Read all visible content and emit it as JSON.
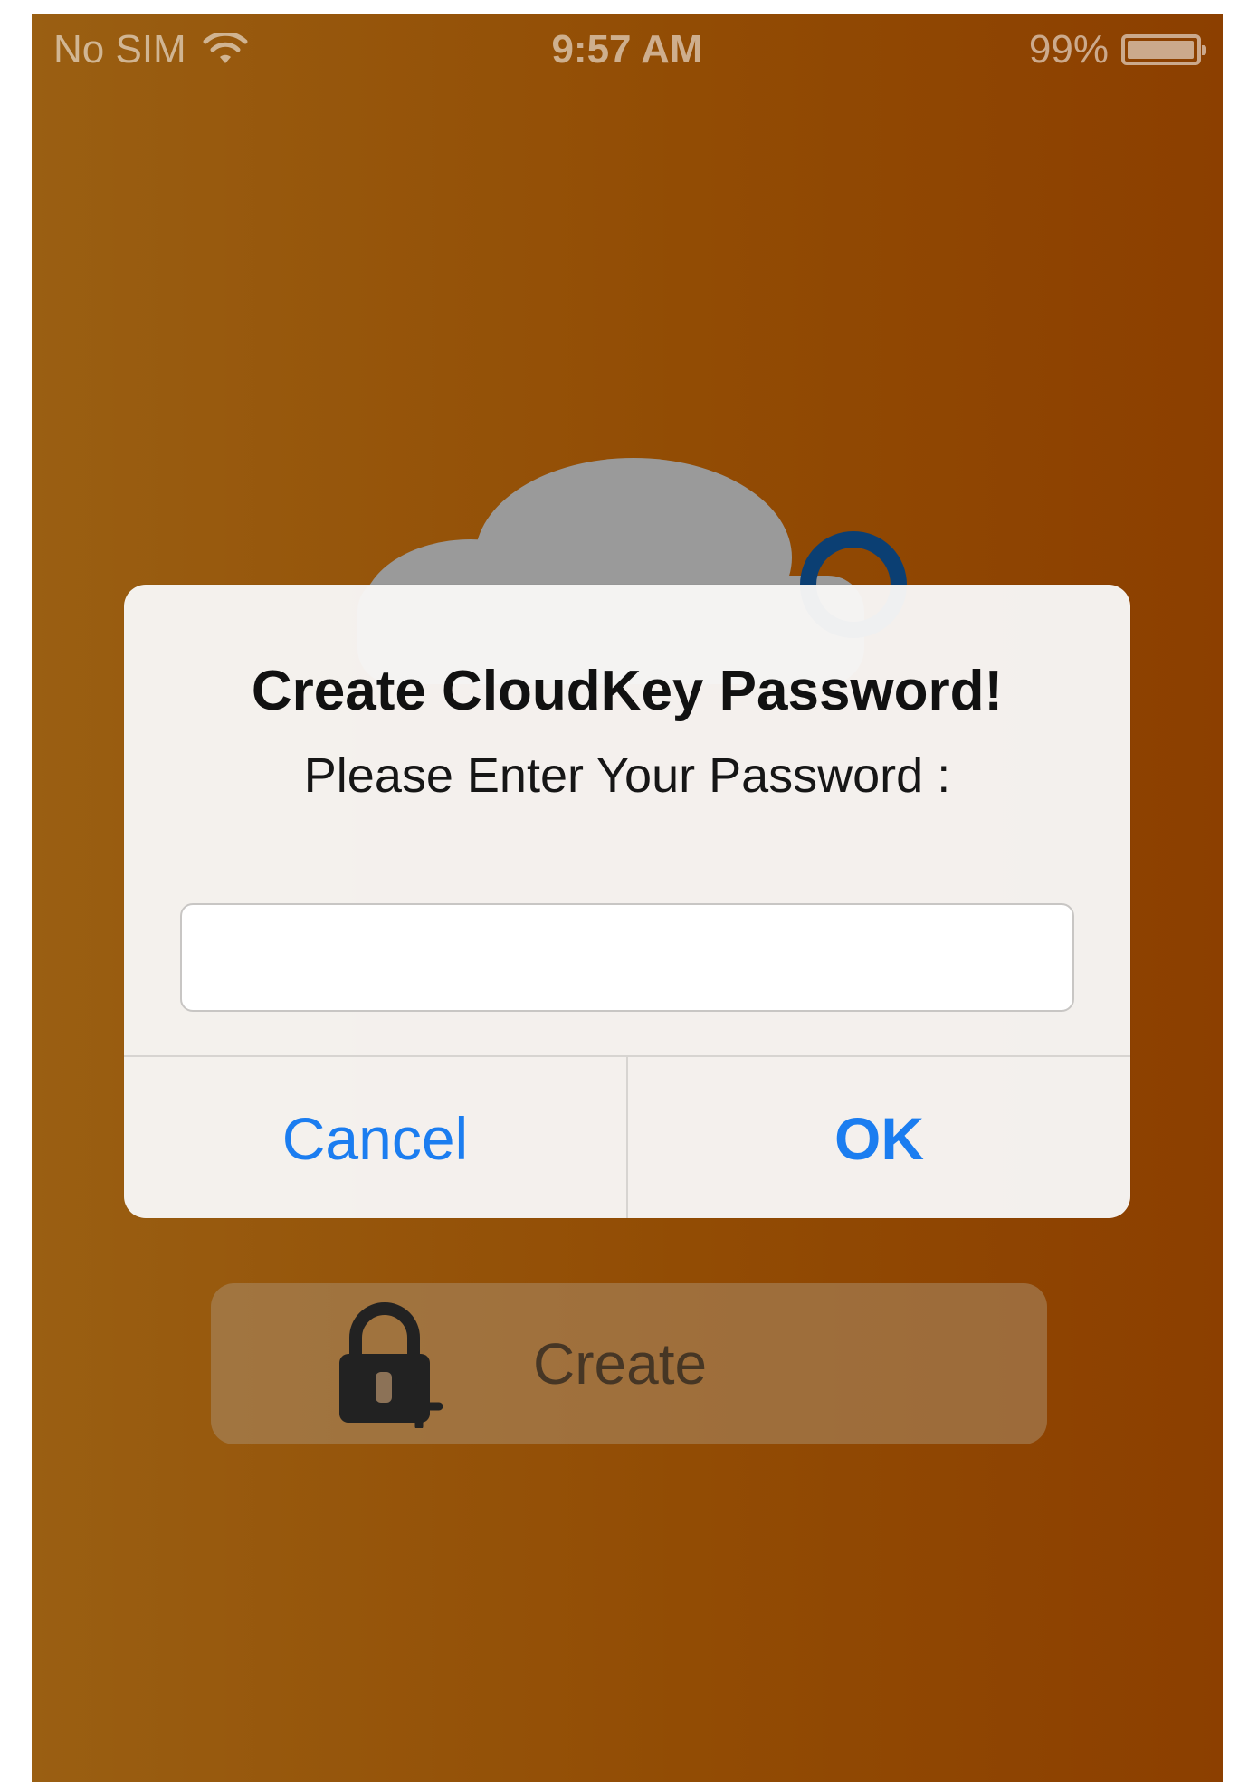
{
  "status_bar": {
    "carrier": "No SIM",
    "time": "9:57 AM",
    "battery": "99%",
    "battery_level": 0.99
  },
  "background": {
    "accent_color": "#924c04",
    "cloud_color": "#9a9a9a",
    "keyring_color": "#0b3f73"
  },
  "alert": {
    "title": "Create CloudKey Password!",
    "message": "Please Enter Your Password :",
    "input": {
      "value": "",
      "placeholder": ""
    },
    "cancel_label": "Cancel",
    "ok_label": "OK",
    "button_color": "#1b7df0"
  },
  "create_button": {
    "label": "Create",
    "icon": "lock-plus-icon"
  }
}
